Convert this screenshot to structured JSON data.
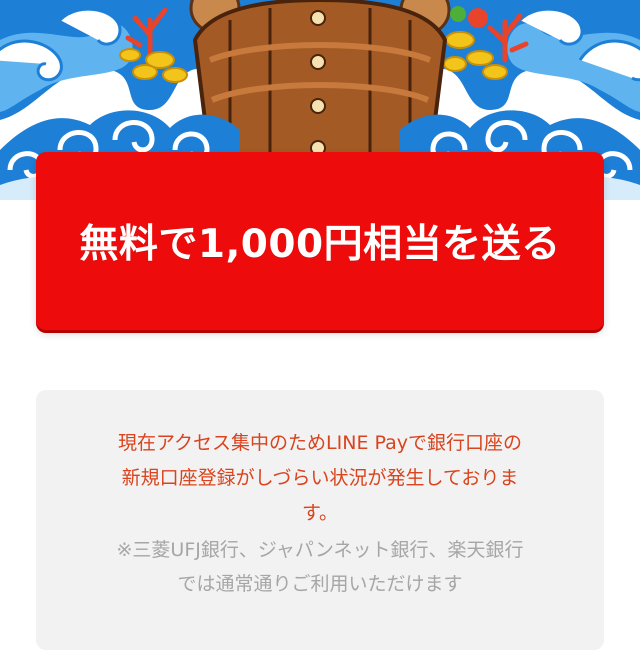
{
  "banner": {
    "image": "treasure-ship-on-waves-illustration"
  },
  "cta": {
    "label": "無料で1,000円相当を送る",
    "color": "#ee0b0b"
  },
  "notice": {
    "main_lines": [
      "現在アクセス集中のためLINE Payで銀行口座の",
      "新規口座登録がしづらい状況が発生しておりま",
      "す。"
    ],
    "sub_lines": [
      "※三菱UFJ銀行、ジャパンネット銀行、楽天銀行",
      "では通常通りご利用いただけます"
    ],
    "main_color": "#d9441e",
    "sub_color": "#a6a6a6",
    "background": "#f2f2f2"
  }
}
